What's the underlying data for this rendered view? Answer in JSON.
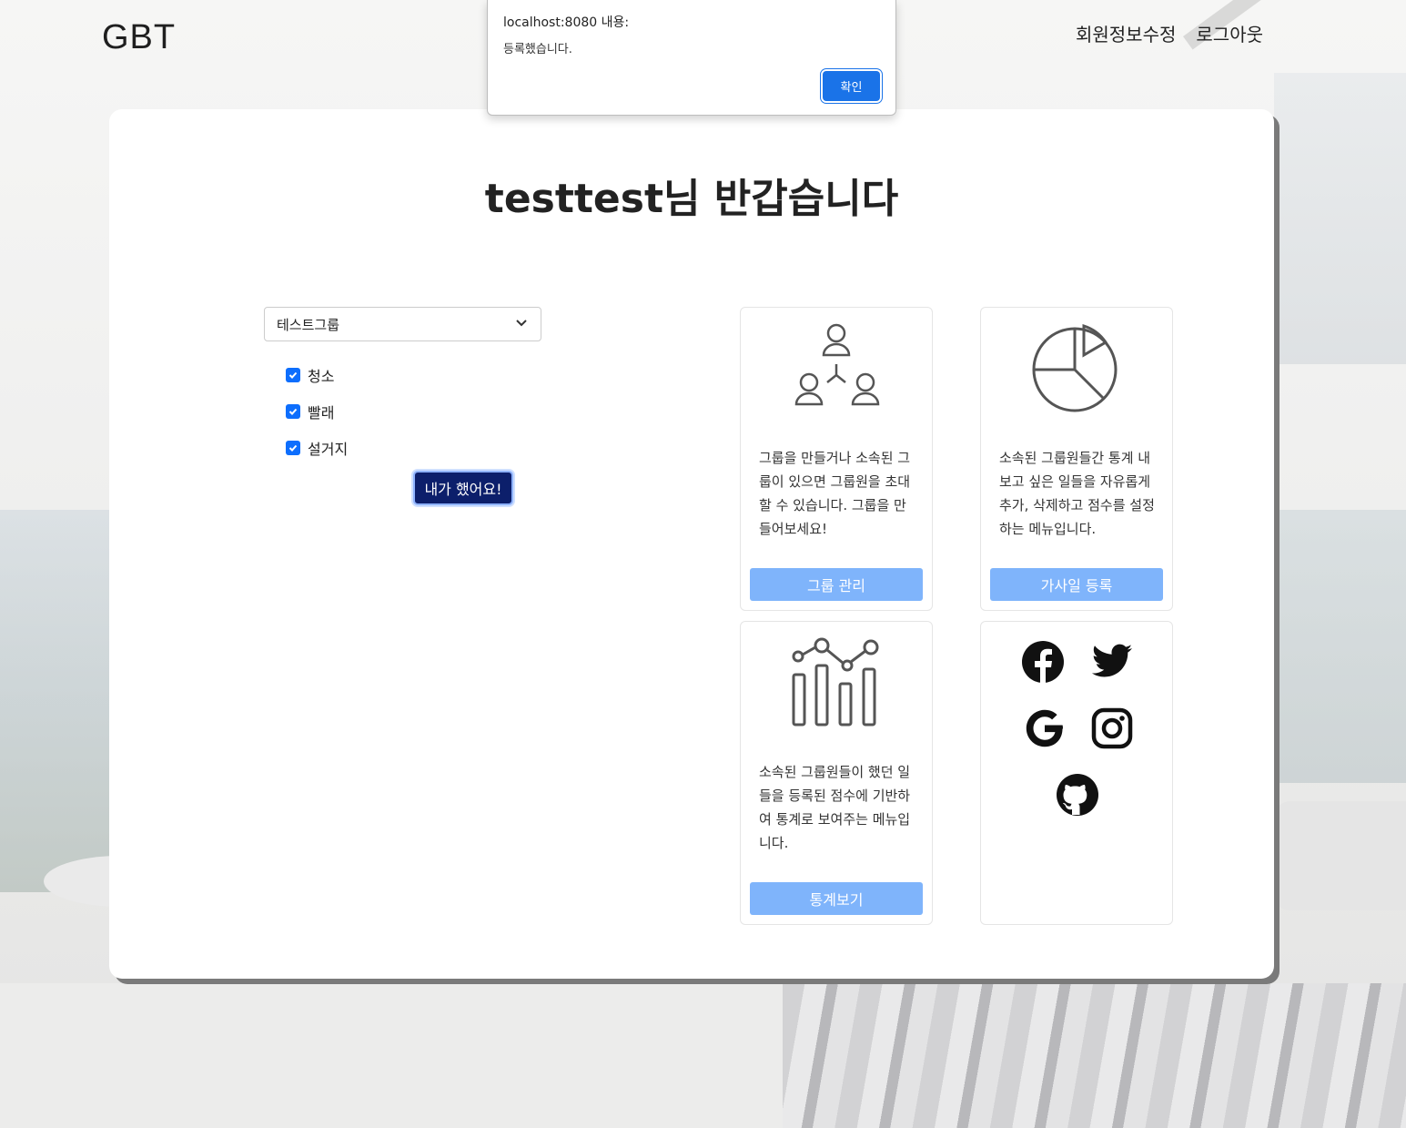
{
  "header": {
    "logo": "GBT",
    "nav": [
      {
        "label": "회원정보수정"
      },
      {
        "label": "로그아웃"
      }
    ]
  },
  "alert": {
    "title": "localhost:8080 내용:",
    "message": "등록했습니다.",
    "ok_label": "확인"
  },
  "main": {
    "greeting": "testtest님 반갑습니다",
    "group_select": {
      "value": "테스트그룹"
    },
    "tasks": [
      {
        "label": "청소",
        "checked": true
      },
      {
        "label": "빨래",
        "checked": true
      },
      {
        "label": "설거지",
        "checked": true
      }
    ],
    "done_button": "내가 했어요!",
    "cards": [
      {
        "icon": "group-network-icon",
        "description": "그룹을 만들거나 소속된 그룹이 있으면 그룹원을 초대할 수 있습니다. 그룹을 만들어보세요!",
        "button": "그룹 관리"
      },
      {
        "icon": "pie-chart-icon",
        "description": "소속된 그룹원들간 통계 내보고 싶은 일들을 자유롭게 추가, 삭제하고 점수를 설정하는 메뉴입니다.",
        "button": "가사일 등록"
      },
      {
        "icon": "bar-line-chart-icon",
        "description": "소속된 그룹원들이 했던 일들을 등록된 점수에 기반하여 통계로 보여주는 메뉴입니다.",
        "button": "통계보기"
      }
    ],
    "social": [
      "facebook-icon",
      "twitter-icon",
      "google-icon",
      "instagram-icon",
      "github-icon"
    ]
  },
  "colors": {
    "primary": "#0d6efd",
    "card_button": "#7fb4fb",
    "done_button": "#0c1f6b",
    "alert_ok": "#1a73e8"
  }
}
